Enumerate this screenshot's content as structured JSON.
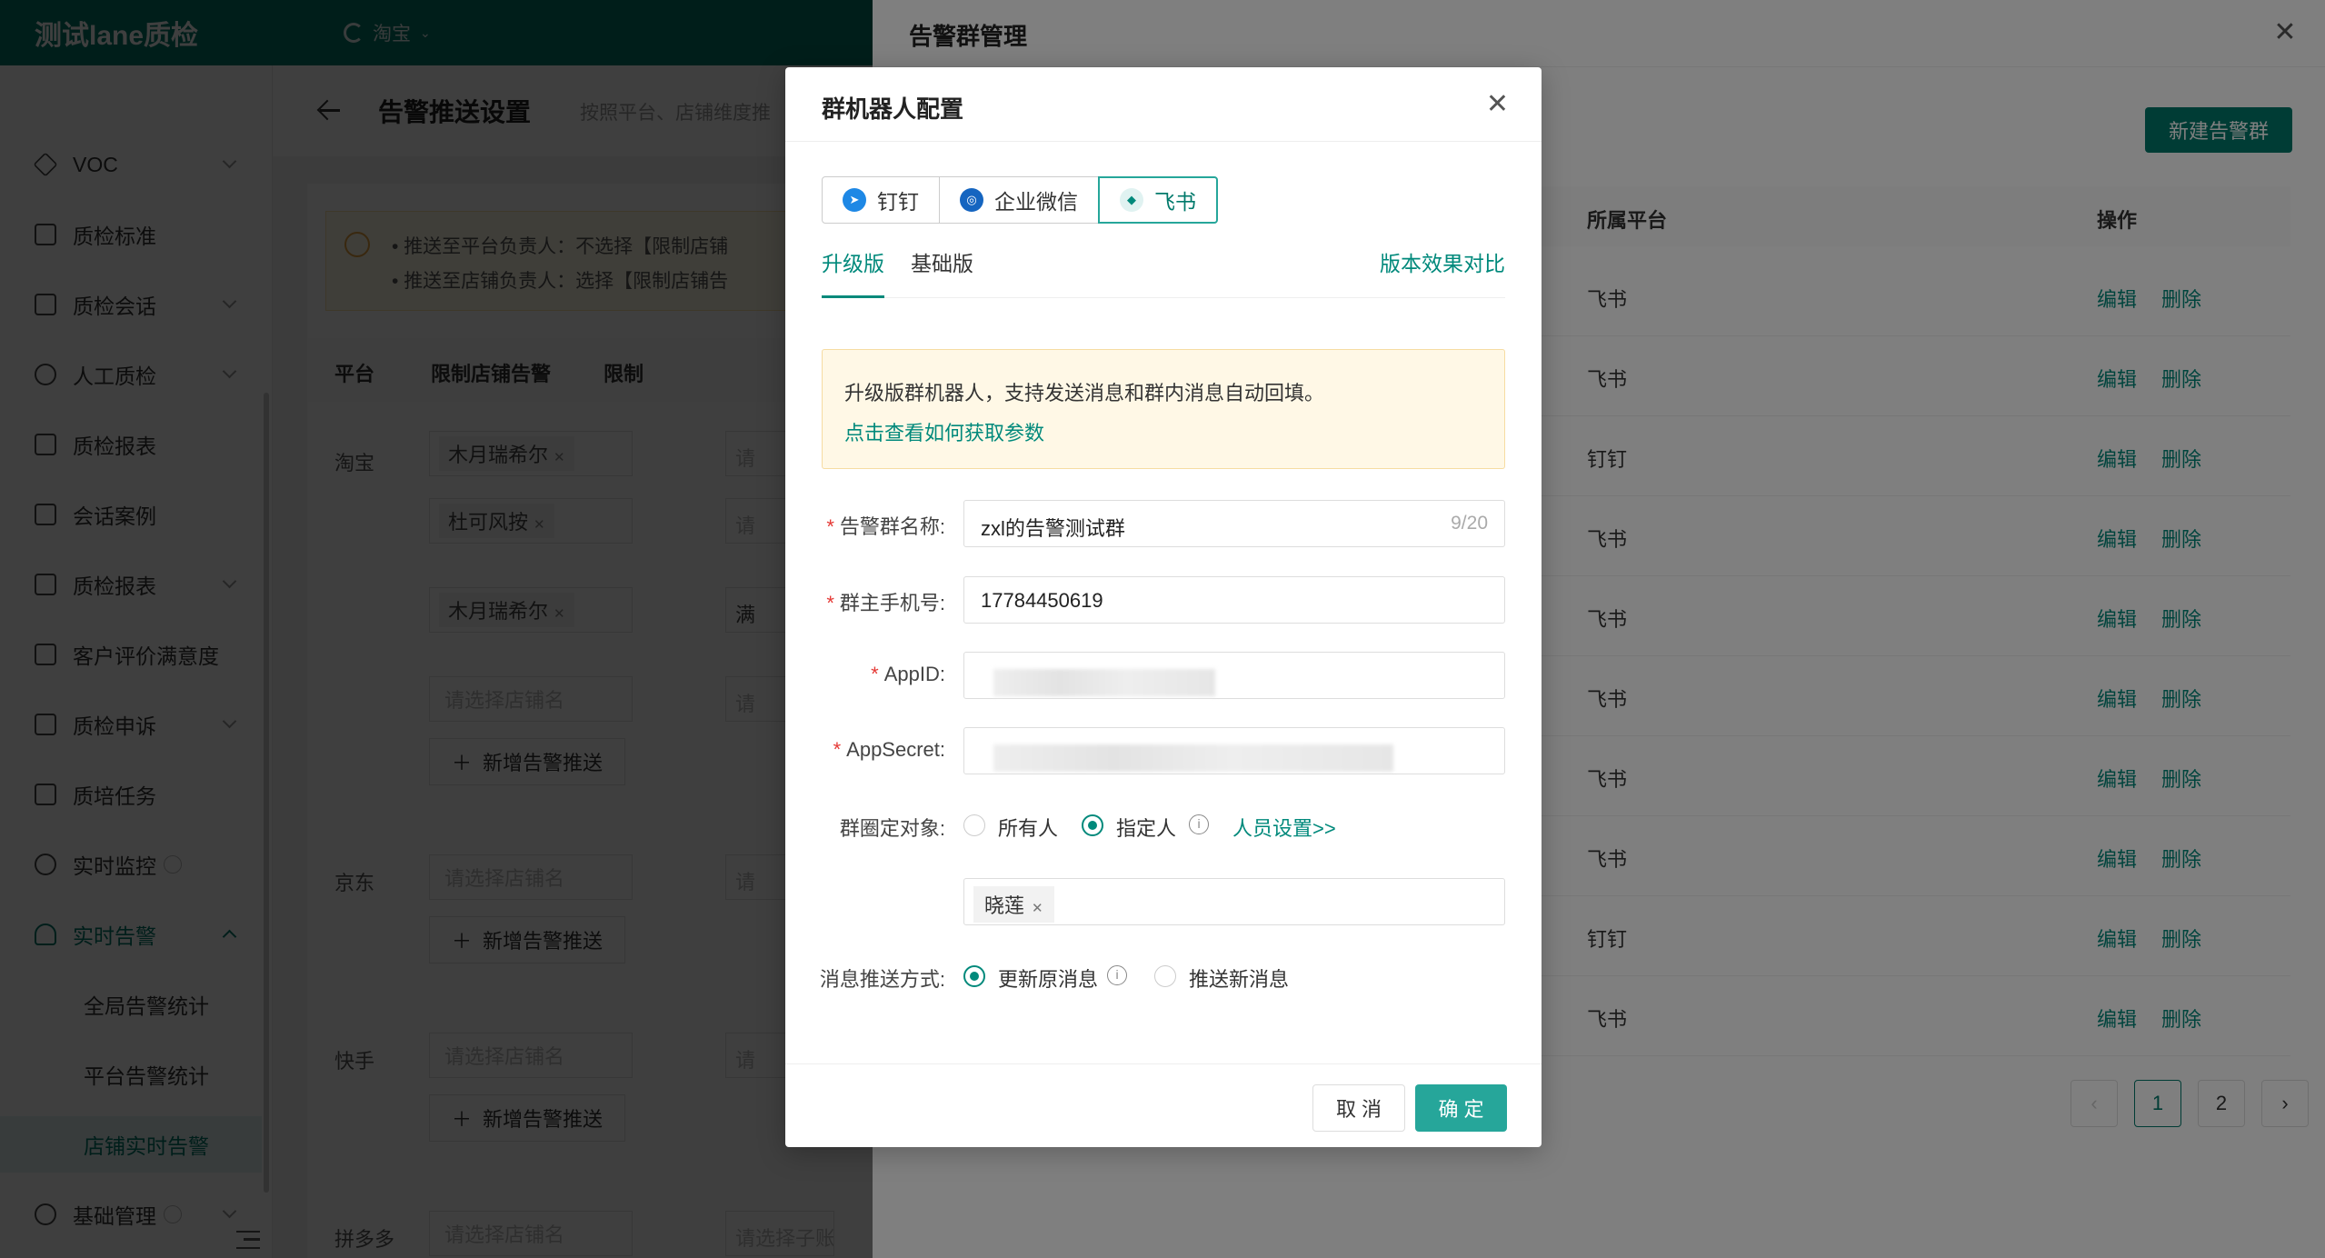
{
  "header": {
    "app_title": "测试lane质检",
    "platform": "淘宝"
  },
  "sidebar": {
    "items": [
      {
        "label": "VOC",
        "icon": "diamond-icon"
      },
      {
        "label": "质检标准",
        "icon": "document-icon"
      },
      {
        "label": "质检会话",
        "icon": "chat-icon"
      },
      {
        "label": "人工质检",
        "icon": "user-icon"
      },
      {
        "label": "质检报表",
        "icon": "report-icon"
      },
      {
        "label": "会话案例",
        "icon": "layers-icon"
      },
      {
        "label": "质检报表",
        "icon": "report-icon"
      },
      {
        "label": "客户评价满意度",
        "icon": "report-icon"
      },
      {
        "label": "质检申诉",
        "icon": "appeal-icon"
      },
      {
        "label": "质培任务",
        "icon": "task-icon"
      },
      {
        "label": "实时监控",
        "icon": "clock-icon"
      },
      {
        "label": "实时告警",
        "icon": "bell-icon"
      },
      {
        "label": "全局告警统计"
      },
      {
        "label": "平台告警统计"
      },
      {
        "label": "店铺实时告警"
      },
      {
        "label": "基础管理",
        "icon": "user-icon"
      }
    ]
  },
  "page": {
    "title": "告警推送设置",
    "subtitle": "按照平台、店铺维度推",
    "notice": [
      "推送至平台负责人：不选择【限制店铺",
      "推送至店铺负责人：选择【限制店铺告"
    ],
    "columns": [
      "平台",
      "限制店铺告警",
      "限制"
    ],
    "platforms": [
      "淘宝",
      "京东",
      "快手",
      "拼多多"
    ],
    "shop_tags": [
      "木月瑞希尔",
      "杜可风按",
      "木月瑞希尔"
    ],
    "shop_placeholder": "请选择店铺名",
    "sub_placeholder": "请选择子账号",
    "add_label": "新增告警推送",
    "col3_values": [
      "请",
      "请",
      "满",
      "请",
      "请",
      "请",
      "请选择子账号"
    ]
  },
  "drawer": {
    "title": "告警群管理",
    "new_button": "新建告警群",
    "columns": {
      "platform": "所属平台",
      "actions": "操作"
    },
    "rows": [
      {
        "platform": "飞书"
      },
      {
        "platform": "飞书"
      },
      {
        "platform": "钉钉"
      },
      {
        "platform": "飞书"
      },
      {
        "platform": "飞书"
      },
      {
        "platform": "飞书"
      },
      {
        "platform": "飞书"
      },
      {
        "platform": "飞书"
      },
      {
        "platform": "钉钉"
      },
      {
        "platform": "飞书"
      }
    ],
    "edit_label": "编辑",
    "delete_label": "删除",
    "pages": [
      "1",
      "2"
    ]
  },
  "modal": {
    "title": "群机器人配置",
    "bot_types": [
      {
        "label": "钉钉",
        "icon": "dingtalk-icon",
        "color": "#1e88e5"
      },
      {
        "label": "企业微信",
        "icon": "wecom-icon",
        "color": "#1565c0"
      },
      {
        "label": "飞书",
        "icon": "feishu-icon",
        "color": "#00897b"
      }
    ],
    "tabs": [
      "升级版",
      "基础版"
    ],
    "compare_link": "版本效果对比",
    "tip_text": "升级版群机器人，支持发送消息和群内消息自动回填。",
    "tip_link": "点击查看如何获取参数",
    "fields": {
      "group_name": {
        "label": "告警群名称:",
        "value": "zxl的告警测试群",
        "count": "9/20"
      },
      "owner_phone": {
        "label": "群主手机号:",
        "value": "17784450619"
      },
      "app_id": {
        "label": "AppID:"
      },
      "app_secret": {
        "label": "AppSecret:"
      }
    },
    "target": {
      "label": "群圈定对象:",
      "options": [
        "所有人",
        "指定人"
      ],
      "selected": "指定人",
      "link": "人员设置>>",
      "selected_people": [
        "晓莲"
      ]
    },
    "push_mode": {
      "label": "消息推送方式:",
      "options": [
        "更新原消息",
        "推送新消息"
      ],
      "selected": "更新原消息"
    },
    "cancel": "取 消",
    "confirm": "确 定"
  },
  "colors": {
    "brand": "#00796b",
    "accent": "#00897b",
    "warning_bg": "#fff8e6",
    "required": "#e53935"
  }
}
